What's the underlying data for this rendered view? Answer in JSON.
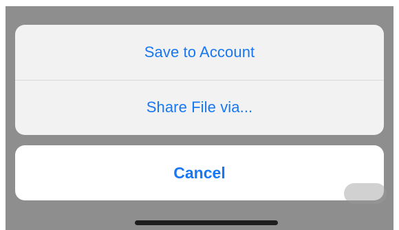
{
  "action_sheet": {
    "actions": [
      {
        "label": "Save to Account"
      },
      {
        "label": "Share File via..."
      }
    ],
    "cancel_label": "Cancel"
  },
  "colors": {
    "accent": "#1877f2",
    "sheet_background": "#f2f2f2",
    "cancel_background": "#ffffff",
    "backdrop": "#8e8e8e",
    "separator": "#d9d9d9",
    "home_indicator": "#1e1e1e"
  }
}
